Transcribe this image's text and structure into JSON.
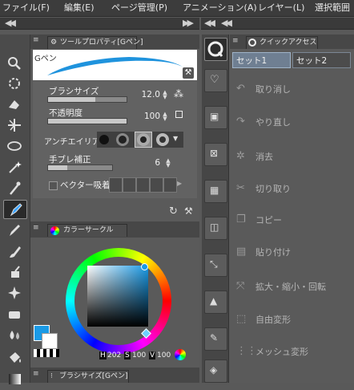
{
  "menu": [
    "ファイル(F)",
    "編集(E)",
    "ページ管理(P)",
    "アニメーション(A)",
    "レイヤー(L)",
    "選択範囲"
  ],
  "tool_property": {
    "tab_label": "ツールプロパティ[Gペン]",
    "brush_name": "Gペン",
    "properties": [
      {
        "label": "ブラシサイズ",
        "value": "12.0",
        "level": 0.6
      },
      {
        "label": "不透明度",
        "value": "100",
        "level": 1.0
      },
      {
        "label": "手ブレ補正",
        "value": "6",
        "level": 0.3
      }
    ],
    "antialias_label": "アンチエイリアス",
    "vector_snap_label": "ベクター吸着"
  },
  "color_circle": {
    "tab_label": "カラーサークル",
    "h_label": "H",
    "h_value": "202",
    "s_label": "S",
    "s_value": "100",
    "v_label": "V",
    "v_value": "100",
    "main_color": "#1a9ae6"
  },
  "brush_size_tab": "ブラシサイズ[Gペン]",
  "quick_access": {
    "tab_label": "クイックアクセス",
    "sets": [
      "セット1",
      "セット2"
    ],
    "items": [
      "取り消し",
      "やり直し",
      "消去",
      "切り取り",
      "コピー",
      "貼り付け",
      "拡大・縮小・回転",
      "自由変形",
      "メッシュ変形"
    ]
  }
}
